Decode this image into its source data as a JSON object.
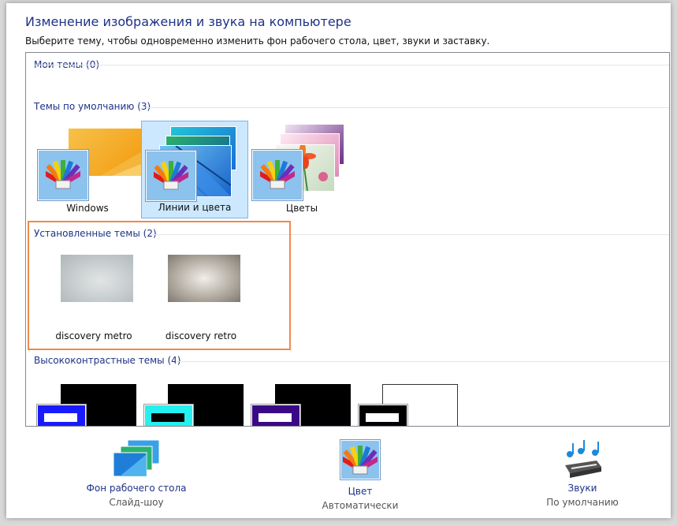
{
  "header": {
    "title": "Изменение изображения и звука на компьютере",
    "subtitle": "Выберите тему, чтобы одновременно изменить фон рабочего стола, цвет, звуки и заставку."
  },
  "groups": {
    "my": {
      "label": "Мои темы (0)"
    },
    "default": {
      "label": "Темы по умолчанию (3)",
      "items": [
        {
          "label": "Windows"
        },
        {
          "label": "Линии и цвета"
        },
        {
          "label": "Цветы"
        }
      ]
    },
    "installed": {
      "label": "Установленные темы (2)",
      "items": [
        {
          "label": "discovery metro"
        },
        {
          "label": "discovery retro"
        }
      ]
    },
    "high_contrast": {
      "label": "Высококонтрастные темы (4)"
    }
  },
  "bottom": {
    "background": {
      "link": "Фон рабочего стола",
      "sub": "Слайд-шоу"
    },
    "color": {
      "link": "Цвет",
      "sub": "Автоматически"
    },
    "sounds": {
      "link": "Звуки",
      "sub": "По умолчанию"
    }
  },
  "colors": {
    "accent": "#1e3287",
    "selection": "#cce8ff",
    "highlight_box": "#ef8a4a"
  }
}
